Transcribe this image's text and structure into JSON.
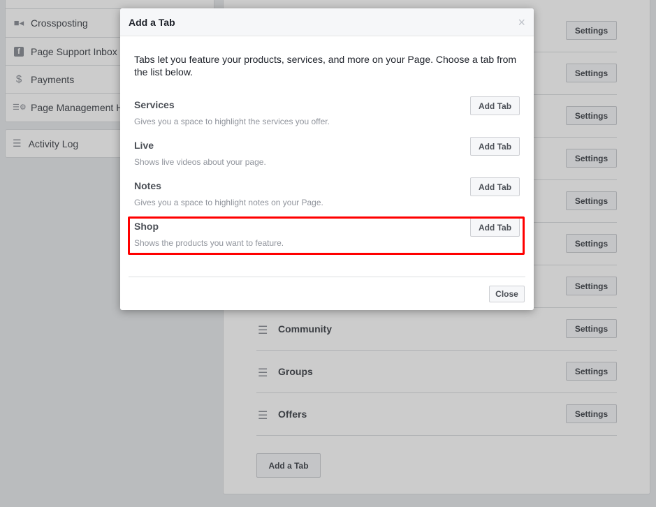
{
  "sidebar": {
    "items": [
      {
        "label": "Crossposting",
        "icon": "video-camera-icon"
      },
      {
        "label": "Page Support Inbox",
        "icon": "facebook-icon"
      },
      {
        "label": "Payments",
        "icon": "dollar-icon"
      },
      {
        "label": "Page Management H",
        "icon": "settings-list-icon"
      }
    ],
    "activity_log": "Activity Log"
  },
  "main": {
    "settings_label": "Settings",
    "rows": [
      {
        "name": "Community"
      },
      {
        "name": "Groups"
      },
      {
        "name": "Offers"
      }
    ],
    "add_tab": "Add a Tab"
  },
  "modal": {
    "title": "Add a Tab",
    "close_glyph": "×",
    "intro": "Tabs let you feature your products, services, and more on your Page. Choose a tab from the list below.",
    "add_label": "Add Tab",
    "options": [
      {
        "title": "Services",
        "desc": "Gives you a space to highlight the services you offer."
      },
      {
        "title": "Live",
        "desc": "Shows live videos about your page."
      },
      {
        "title": "Notes",
        "desc": "Gives you a space to highlight notes on your Page."
      },
      {
        "title": "Shop",
        "desc": "Shows the products you want to feature.",
        "highlighted": true
      }
    ],
    "close_label": "Close"
  },
  "colors": {
    "highlight": "#ff0000"
  }
}
